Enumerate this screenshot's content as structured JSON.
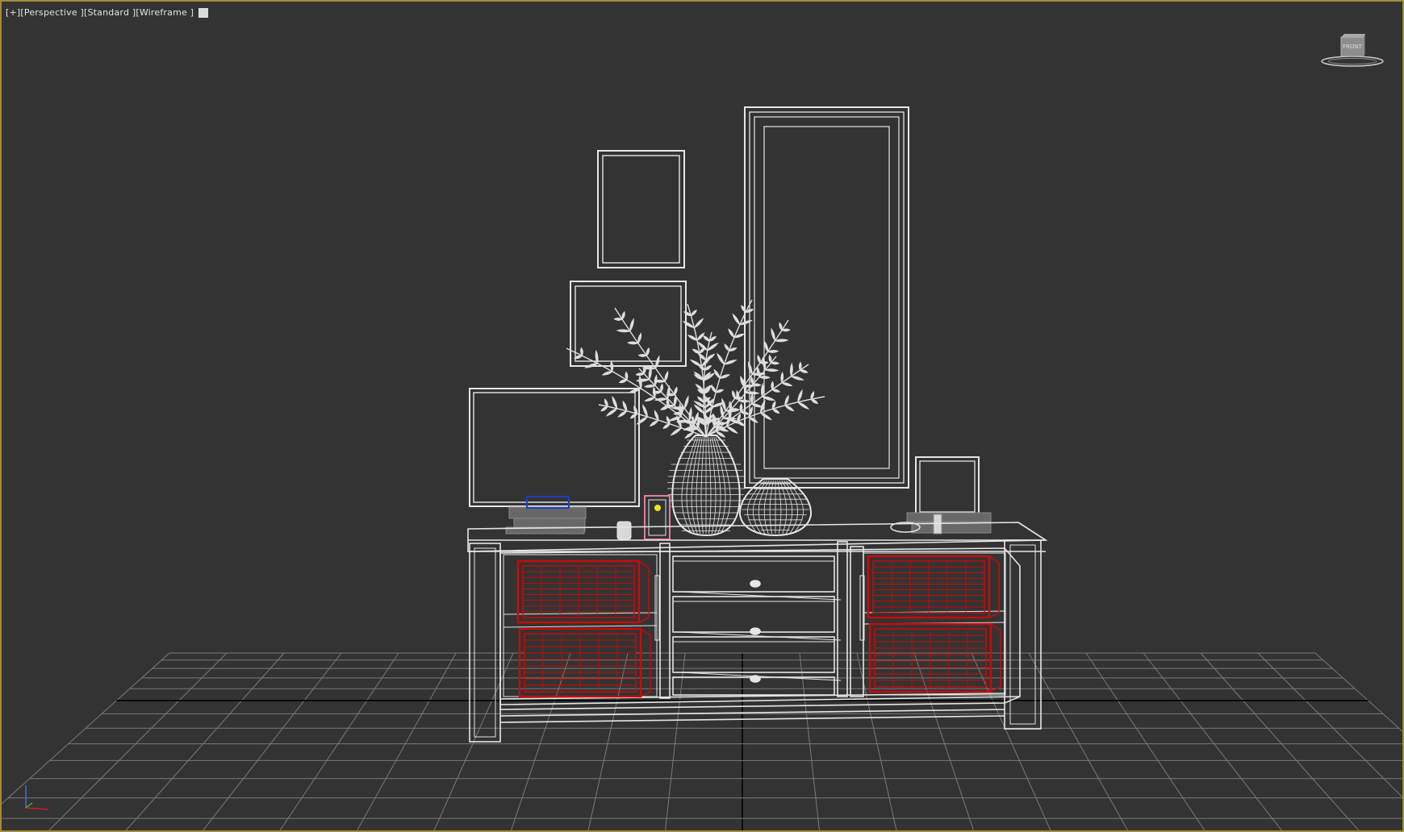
{
  "viewport": {
    "label_plus": "[+]",
    "label_view": "[Perspective ]",
    "label_shading": "[Standard ]",
    "label_mode": "[Wireframe ]",
    "border_color": "#a38a3c",
    "background": "#333333"
  },
  "viewcube": {
    "face_label": "FRONT"
  },
  "colors": {
    "wire": "#e6e6e6",
    "selected": "#cc0a0a",
    "grid": "#7a7a7a",
    "grid_axis": "#0b0b0b",
    "dark_objects": "#6a6a6a"
  },
  "icons": [
    "viewcube-icon",
    "axis-tripod-icon",
    "shading-swatch-icon"
  ]
}
